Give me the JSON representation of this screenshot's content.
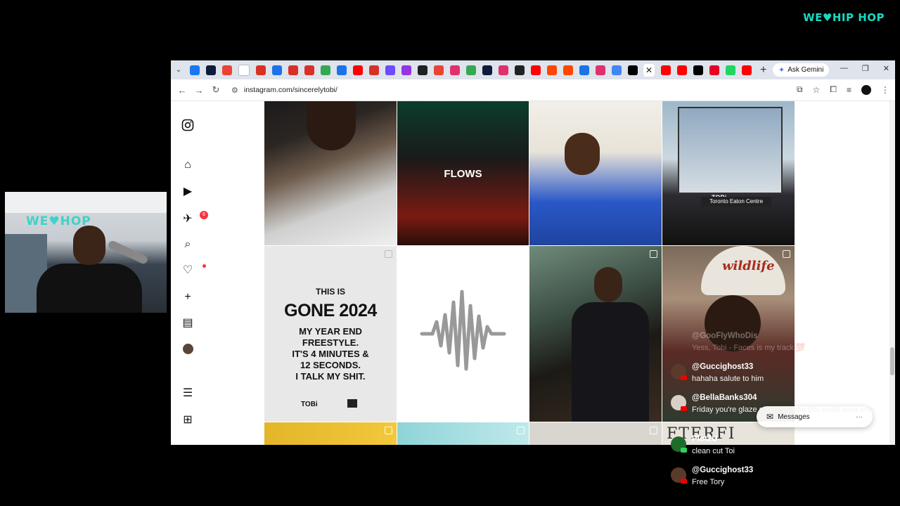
{
  "brand": {
    "text_a": "WE",
    "heart": "♥",
    "text_b": "HIP HOP"
  },
  "webcam": {
    "sign": "WE♥HOP"
  },
  "browser": {
    "tab_close": "✕",
    "new_tab": "+",
    "gemini_label": "Ask Gemini",
    "url": "instagram.com/sincerelytobi/",
    "tab_colors": [
      "#1877f2",
      "#0f1b3d",
      "#ea4335",
      "#ffffff",
      "#d93025",
      "#1a73e8",
      "#d93025",
      "#d93025",
      "#34a853",
      "#1a73e8",
      "#ff0000",
      "#d93025",
      "#6b4cff",
      "#9334e6",
      "#202124",
      "#ea4335",
      "#e1306c",
      "#34a853",
      "#0f1b3d",
      "#e1306c",
      "#202124",
      "#ff0000",
      "#ff4500",
      "#ff4500",
      "#1a73e8",
      "#e1306c",
      "#4285f4",
      "#000000"
    ],
    "tab_colors_after": [
      "#ff0000",
      "#ff0000",
      "#000000",
      "#e60023",
      "#1ed760",
      "#ff0000"
    ]
  },
  "posts": [
    {
      "title": ""
    },
    {
      "title": "FLOWS"
    },
    {
      "title": ""
    },
    {
      "title": "",
      "billboard_tag": "TOBi",
      "billboard_sign": "Toronto Eaton Centre"
    },
    {
      "lines": [
        "THIS IS",
        "GONE 2024",
        "MY YEAR END",
        "FREESTYLE.",
        "IT'S 4 MINUTES &",
        "12 SECONDS.",
        "I TALK MY SHIT."
      ],
      "footer": "TOBi"
    },
    {
      "title": ""
    },
    {
      "title": ""
    },
    {
      "title": "",
      "cap_text": "wildlife",
      "partial_text": "FTERFI"
    }
  ],
  "messages_label": "Messages",
  "chat": [
    {
      "user": "@GooFlyWhoDis",
      "text": "Yess, Tobi - Faces is my track 💯",
      "faded": true
    },
    {
      "user": "@Guccighost33",
      "text": "hahaha salute to him"
    },
    {
      "user": "@BellaBanks304",
      "text": "Friday you're glaze game is outta this world wow smh"
    },
    {
      "user": "Plot2U",
      "text": "clean cut Toi"
    },
    {
      "user": "@Guccighost33",
      "text": "Free Tory"
    }
  ],
  "colors": {
    "ig_badge": "#ff3040",
    "brand": "#19d9c2"
  },
  "ig_badge_count": "6"
}
